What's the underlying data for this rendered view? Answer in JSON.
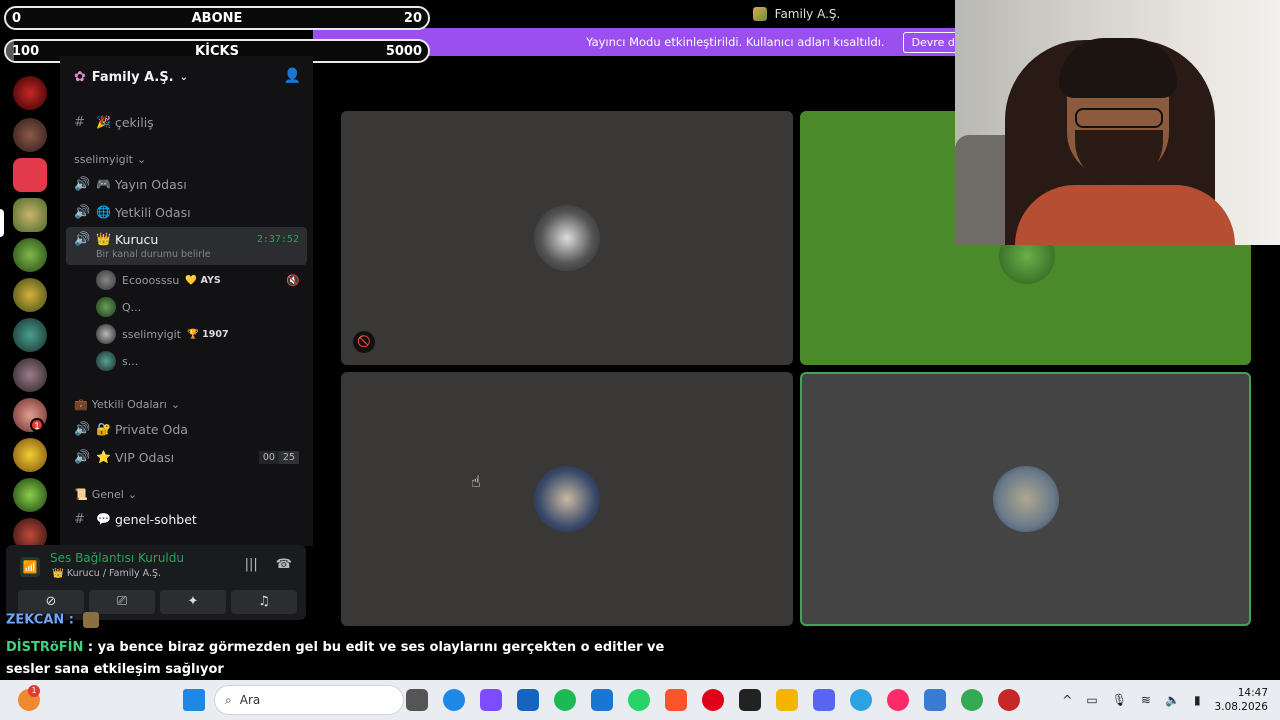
{
  "window": {
    "title": "Family A.Ş."
  },
  "banner": {
    "text": "Yayıncı Modu etkinleştirildi. Kullanıcı adları kısaltıldı.",
    "button": "Devre dışı bırak"
  },
  "overlay": {
    "abone": {
      "min": "0",
      "label": "ABONE",
      "max": "20",
      "progress": 0
    },
    "kicks": {
      "min": "100",
      "label": "KİCKS",
      "max": "5000",
      "progress": 0.02
    }
  },
  "server": {
    "name": "Family A.Ş."
  },
  "channels": {
    "cekilis": "çekiliş",
    "cat_sselim": "sselimyigit",
    "yayin": "Yayın Odası",
    "yetkili": "Yetkili Odası",
    "kurucu": "Kurucu",
    "kurucu_time": "2:37:52",
    "kurucu_status": "Bir kanal durumu belirle",
    "users": [
      {
        "name": "Ecooosssu",
        "tag": "AYS"
      },
      {
        "name": "Q...",
        "tag": ""
      },
      {
        "name": "sselimyigit",
        "tag": "1907"
      },
      {
        "name": "s...",
        "tag": ""
      }
    ],
    "cat_yetkili": "Yetkili Odaları",
    "private": "Private Oda",
    "vip": "VIP Odası",
    "vip_count": "00",
    "vip_limit": "25",
    "cat_genel": "Genel",
    "genel_sohbet": "genel-sohbet"
  },
  "voice": {
    "status": "Ses Bağlantısı Kuruldu",
    "location": "Kurucu / Family A.Ş."
  },
  "chat": {
    "line1_name": "ZEKCAN :",
    "line2_name": "DİSTRöFİN",
    "line2_text": " : ya bence biraz görmezden gel bu edit ve ses olaylarını gerçekten o editler ve",
    "line3_text": "sesler sana etkileşim sağlıyor"
  },
  "taskbar": {
    "search": "Ara",
    "time": "14:47",
    "date": "3.08.2026",
    "notif": "1"
  },
  "colors": {
    "banner": "#9b4ff0",
    "accent_green": "#23a55a",
    "tile_green": "#4a8a2a"
  }
}
